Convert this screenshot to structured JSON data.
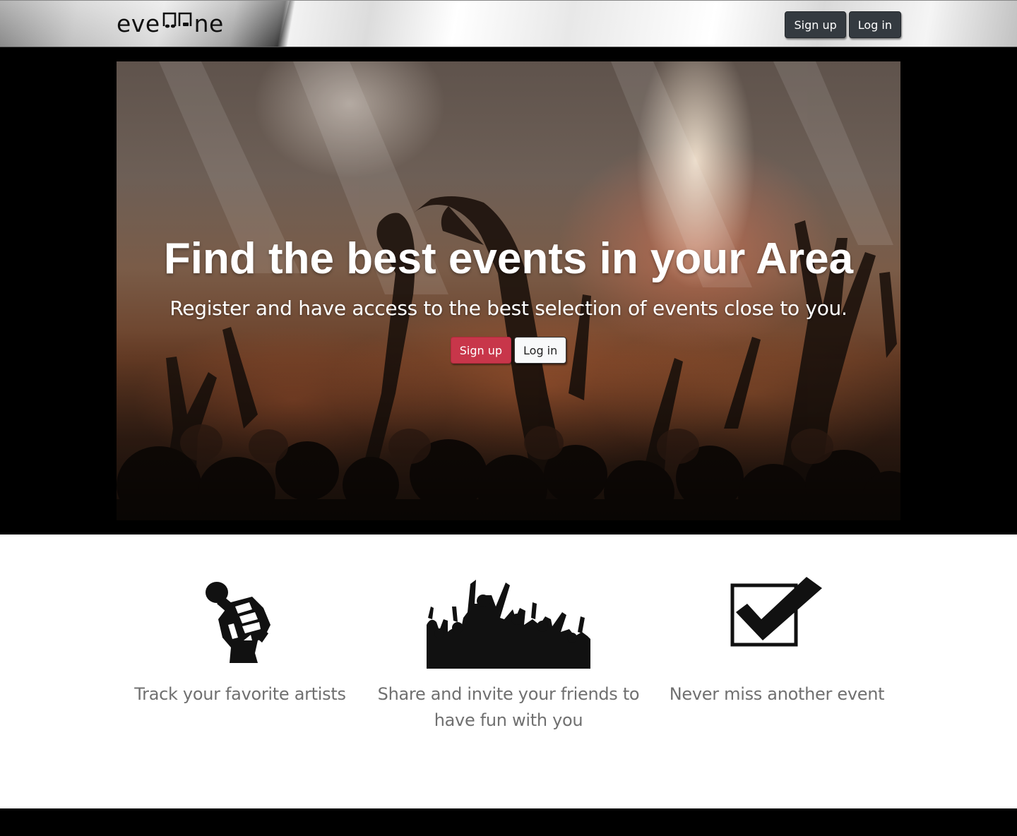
{
  "navbar": {
    "brand_left": "eve",
    "brand_right": "ne",
    "brand_icon": "music-notes-icon",
    "signup_label": "Sign up",
    "login_label": "Log in"
  },
  "hero": {
    "title": "Find the best events in your Area",
    "subtitle": "Register and have access to the best selection of events close to you.",
    "signup_label": "Sign up",
    "login_label": "Log in"
  },
  "features": [
    {
      "icon": "microphone-fist-icon",
      "caption": "Track your favorite artists"
    },
    {
      "icon": "crowd-icon",
      "caption": "Share and invite your friends to have fun with you"
    },
    {
      "icon": "checkbox-icon",
      "caption": "Never miss another event"
    }
  ],
  "colors": {
    "accent_red": "#c8364a",
    "dark_button": "#343a40",
    "caption_gray": "#707070"
  }
}
